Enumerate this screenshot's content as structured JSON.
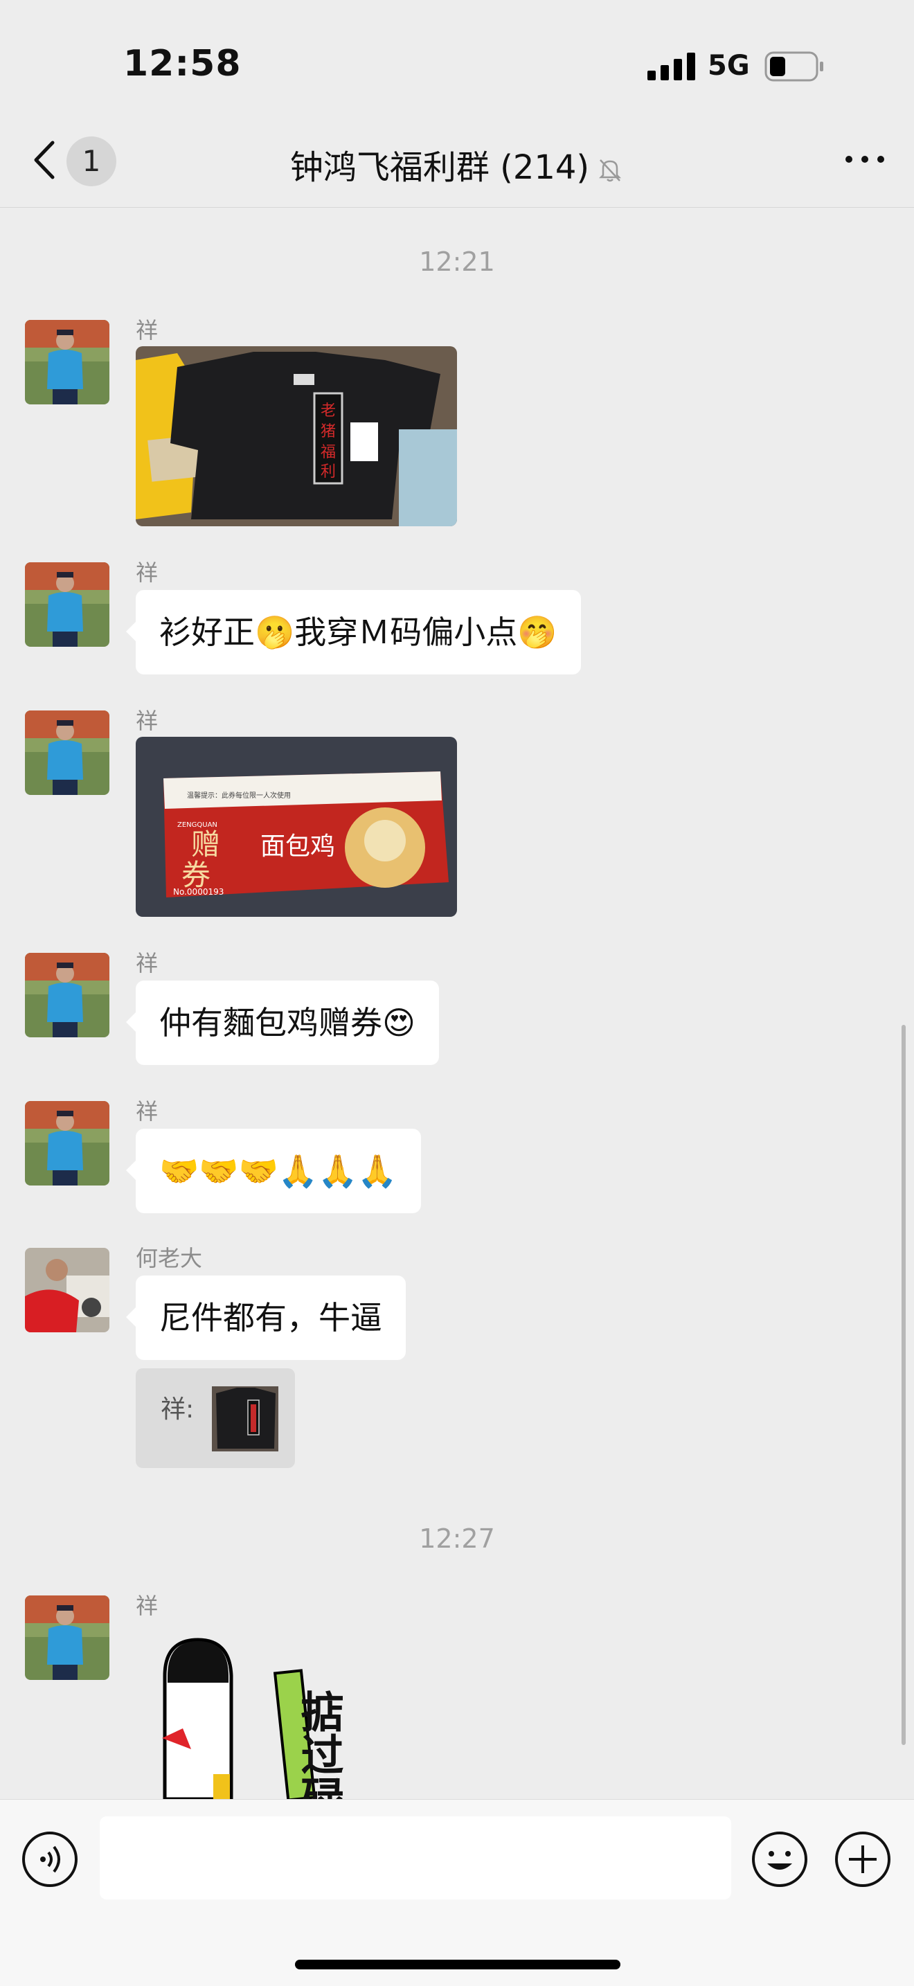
{
  "status": {
    "time": "12:58",
    "network": "5G"
  },
  "nav": {
    "unread": "1",
    "title": "钟鸿飞福利群 (214)"
  },
  "messages": {
    "sep1": "12:21",
    "m1_sender": "祥",
    "m2_sender": "祥",
    "m2_text": "衫好正🫢我穿Ｍ码偏小点🤭",
    "m3_sender": "祥",
    "m4_sender": "祥",
    "m4_text": "仲有麵包鸡赠券😍",
    "m5_sender": "祥",
    "m5_text": "🤝🤝🤝🙏🙏🙏",
    "m6_sender": "何老大",
    "m6_text": "尼件都有，牛逼",
    "quote_label": "祥:",
    "sep2": "12:27",
    "m7_sender": "祥",
    "sticker_text": "掂过碌"
  },
  "ticket": {
    "line1": "ZENGQUAN",
    "big1": "赠",
    "big2": "券",
    "brand": "面包鸡",
    "number": "No.0000193",
    "top_note": "温馨提示：此券每位限一人次使用"
  },
  "shirt": {
    "label": "老猪福利"
  },
  "input": {
    "placeholder": ""
  },
  "icons": {
    "mute": "bell-slash-icon",
    "back": "chevron-left-icon",
    "more": "ellipsis-icon",
    "voice": "voice-icon",
    "emoji": "smile-icon",
    "plus": "plus-icon"
  }
}
